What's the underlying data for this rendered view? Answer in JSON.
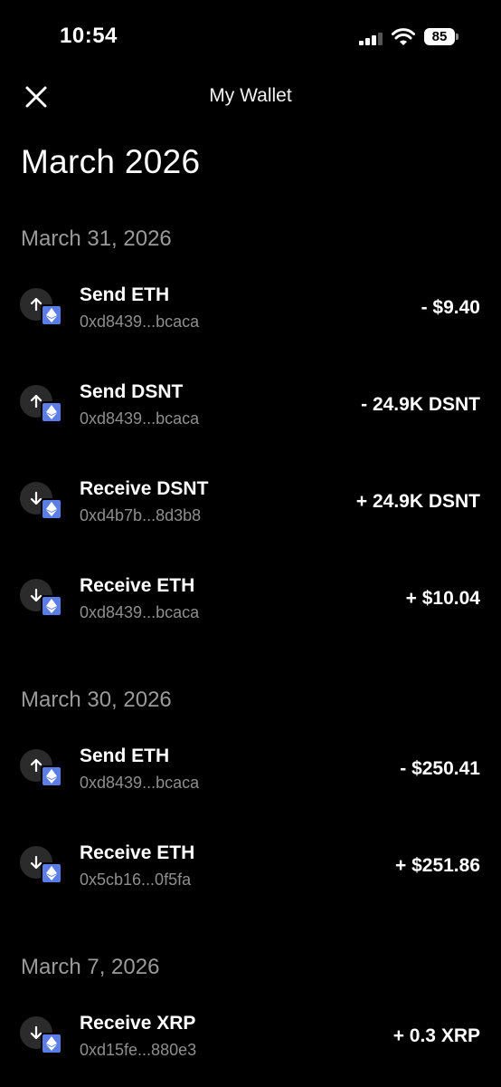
{
  "status_bar": {
    "time": "10:54",
    "battery": "85"
  },
  "header": {
    "title": "My Wallet"
  },
  "month_title": "March 2026",
  "sections": [
    {
      "date": "March 31, 2026",
      "transactions": [
        {
          "direction": "send",
          "title": "Send ETH",
          "address": "0xd8439...bcaca",
          "amount": "- $9.40"
        },
        {
          "direction": "send",
          "title": "Send DSNT",
          "address": "0xd8439...bcaca",
          "amount": "- 24.9K DSNT"
        },
        {
          "direction": "receive",
          "title": "Receive DSNT",
          "address": "0xd4b7b...8d3b8",
          "amount": "+ 24.9K DSNT"
        },
        {
          "direction": "receive",
          "title": "Receive ETH",
          "address": "0xd8439...bcaca",
          "amount": "+ $10.04"
        }
      ]
    },
    {
      "date": "March 30, 2026",
      "transactions": [
        {
          "direction": "send",
          "title": "Send ETH",
          "address": "0xd8439...bcaca",
          "amount": "- $250.41"
        },
        {
          "direction": "receive",
          "title": "Receive ETH",
          "address": "0x5cb16...0f5fa",
          "amount": "+ $251.86"
        }
      ]
    },
    {
      "date": "March 7, 2026",
      "transactions": [
        {
          "direction": "receive",
          "title": "Receive XRP",
          "address": "0xd15fe...880e3",
          "amount": "+ 0.3 XRP"
        }
      ]
    }
  ],
  "colors": {
    "background": "#000000",
    "badge": "#5b7de8",
    "muted": "#8e8e8e"
  },
  "icons": {
    "send": "arrow-up-icon",
    "receive": "arrow-down-icon",
    "network": "ethereum-icon",
    "close": "close-icon"
  }
}
